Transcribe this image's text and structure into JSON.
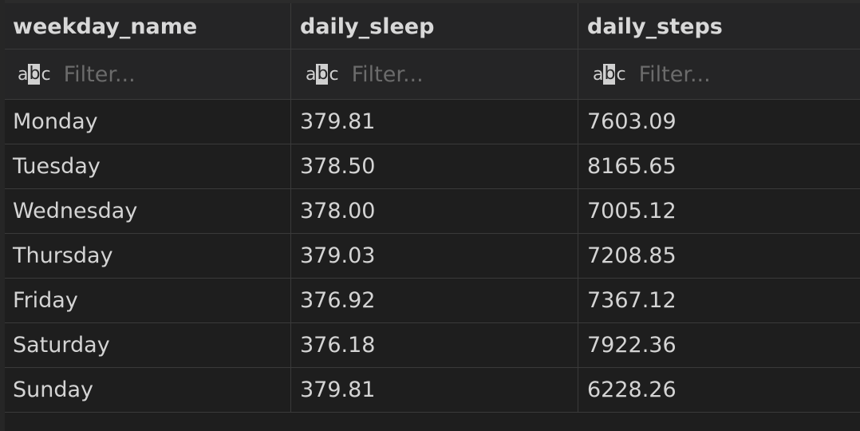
{
  "columns": [
    "weekday_name",
    "daily_sleep",
    "daily_steps"
  ],
  "filter_placeholder": "Filter...",
  "rows": [
    [
      "Monday",
      "379.81",
      "7603.09"
    ],
    [
      "Tuesday",
      "378.50",
      "8165.65"
    ],
    [
      "Wednesday",
      "378.00",
      "7005.12"
    ],
    [
      "Thursday",
      "379.03",
      "7208.85"
    ],
    [
      "Friday",
      "376.92",
      "7367.12"
    ],
    [
      "Saturday",
      "376.18",
      "7922.36"
    ],
    [
      "Sunday",
      "379.81",
      "6228.26"
    ]
  ],
  "colors": {
    "background": "#1e1e1e",
    "header_background": "#252526",
    "grid_line": "#3a3a3a",
    "text": "#d4d4d4",
    "placeholder": "#6b6b6b"
  },
  "icons": {
    "filter_type": "text-type-icon"
  }
}
